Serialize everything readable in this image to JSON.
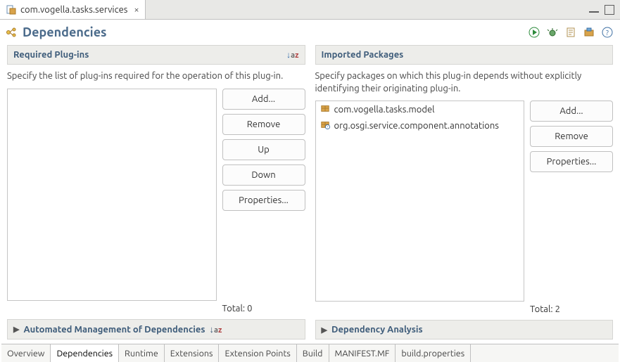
{
  "editorTab": {
    "label": "com.vogella.tasks.services"
  },
  "header": {
    "title": "Dependencies"
  },
  "required": {
    "title": "Required Plug-ins",
    "desc": "Specify the list of plug-ins required for the operation of this plug-in.",
    "buttons": {
      "add": "Add...",
      "remove": "Remove",
      "up": "Up",
      "down": "Down",
      "props": "Properties..."
    },
    "total_label": "Total: 0",
    "items": []
  },
  "imported": {
    "title": "Imported Packages",
    "desc": "Specify packages on which this plug-in depends without explicitly identifying their originating plug-in.",
    "buttons": {
      "add": "Add...",
      "remove": "Remove",
      "props": "Properties..."
    },
    "total_label": "Total: 2",
    "items": [
      {
        "label": "com.vogella.tasks.model"
      },
      {
        "label": "org.osgi.service.component.annotations"
      }
    ]
  },
  "collapsed": {
    "autoMgmt": "Automated Management of Dependencies",
    "depAnalysis": "Dependency Analysis"
  },
  "bottomTabs": [
    "Overview",
    "Dependencies",
    "Runtime",
    "Extensions",
    "Extension Points",
    "Build",
    "MANIFEST.MF",
    "build.properties"
  ],
  "activeBottomTab": "Dependencies"
}
